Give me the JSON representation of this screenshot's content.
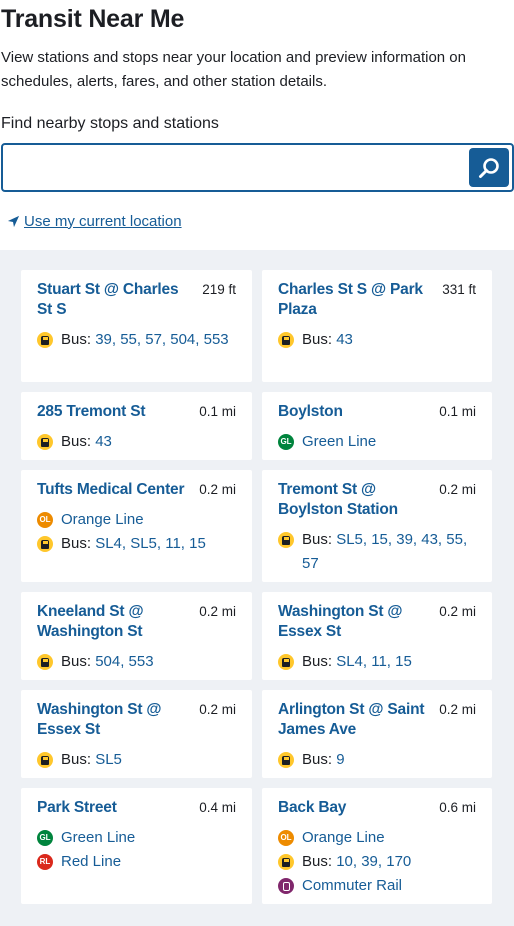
{
  "header": {
    "title": "Transit Near Me",
    "intro": "View stations and stops near your location and preview information on schedules, alerts, fares, and other station details.",
    "search_label": "Find nearby stops and stations",
    "search_value": "",
    "location_link": "Use my current location"
  },
  "stops": [
    {
      "name": "Stuart St @ Charles St S",
      "distance": "219 ft",
      "routes": [
        {
          "icon": "bus-icon",
          "prefix": "Bus: ",
          "links": "39, 55, 57, 504, 553"
        }
      ]
    },
    {
      "name": "Charles St S @ Park Plaza",
      "distance": "331 ft",
      "routes": [
        {
          "icon": "bus-icon",
          "prefix": "Bus: ",
          "links": "43"
        }
      ]
    },
    {
      "name": "285 Tremont St",
      "distance": "0.1 mi",
      "routes": [
        {
          "icon": "bus-icon",
          "prefix": "Bus: ",
          "links": "43"
        }
      ]
    },
    {
      "name": "Boylston",
      "distance": "0.1 mi",
      "routes": [
        {
          "icon": "green-line-icon",
          "prefix": "",
          "links": "Green Line"
        }
      ]
    },
    {
      "name": "Tufts Medical Center",
      "distance": "0.2 mi",
      "routes": [
        {
          "icon": "orange-line-icon",
          "prefix": "",
          "links": "Orange Line"
        },
        {
          "icon": "bus-icon",
          "prefix": "Bus: ",
          "links": "SL4, SL5, 11, 15"
        }
      ]
    },
    {
      "name": "Tremont St @ Boylston Station",
      "distance": "0.2 mi",
      "routes": [
        {
          "icon": "bus-icon",
          "prefix": "Bus: ",
          "links": "SL5, 15, 39, 43, 55, 57"
        }
      ]
    },
    {
      "name": "Kneeland St @ Washington St",
      "distance": "0.2 mi",
      "routes": [
        {
          "icon": "bus-icon",
          "prefix": "Bus: ",
          "links": "504, 553"
        }
      ]
    },
    {
      "name": "Washington St @ Essex St",
      "distance": "0.2 mi",
      "routes": [
        {
          "icon": "bus-icon",
          "prefix": "Bus: ",
          "links": "SL4, 11, 15"
        }
      ]
    },
    {
      "name": "Washington St @ Essex St",
      "distance": "0.2 mi",
      "routes": [
        {
          "icon": "bus-icon",
          "prefix": "Bus: ",
          "links": "SL5"
        }
      ]
    },
    {
      "name": "Arlington St @ Saint James Ave",
      "distance": "0.2 mi",
      "routes": [
        {
          "icon": "bus-icon",
          "prefix": "Bus: ",
          "links": "9"
        }
      ]
    },
    {
      "name": "Park Street",
      "distance": "0.4 mi",
      "routes": [
        {
          "icon": "green-line-icon",
          "prefix": "",
          "links": "Green Line"
        },
        {
          "icon": "red-line-icon",
          "prefix": "",
          "links": "Red Line"
        }
      ]
    },
    {
      "name": "Back Bay",
      "distance": "0.6 mi",
      "routes": [
        {
          "icon": "orange-line-icon",
          "prefix": "",
          "links": "Orange Line"
        },
        {
          "icon": "bus-icon",
          "prefix": "Bus: ",
          "links": "10, 39, 170"
        },
        {
          "icon": "commuter-rail-icon",
          "prefix": "",
          "links": "Commuter Rail"
        }
      ]
    }
  ],
  "colors": {
    "brand": "#165c96",
    "bus": "#ffc72c",
    "green_line": "#00843d",
    "orange_line": "#ed8b00",
    "red_line": "#da291c",
    "commuter_rail": "#80276c"
  }
}
